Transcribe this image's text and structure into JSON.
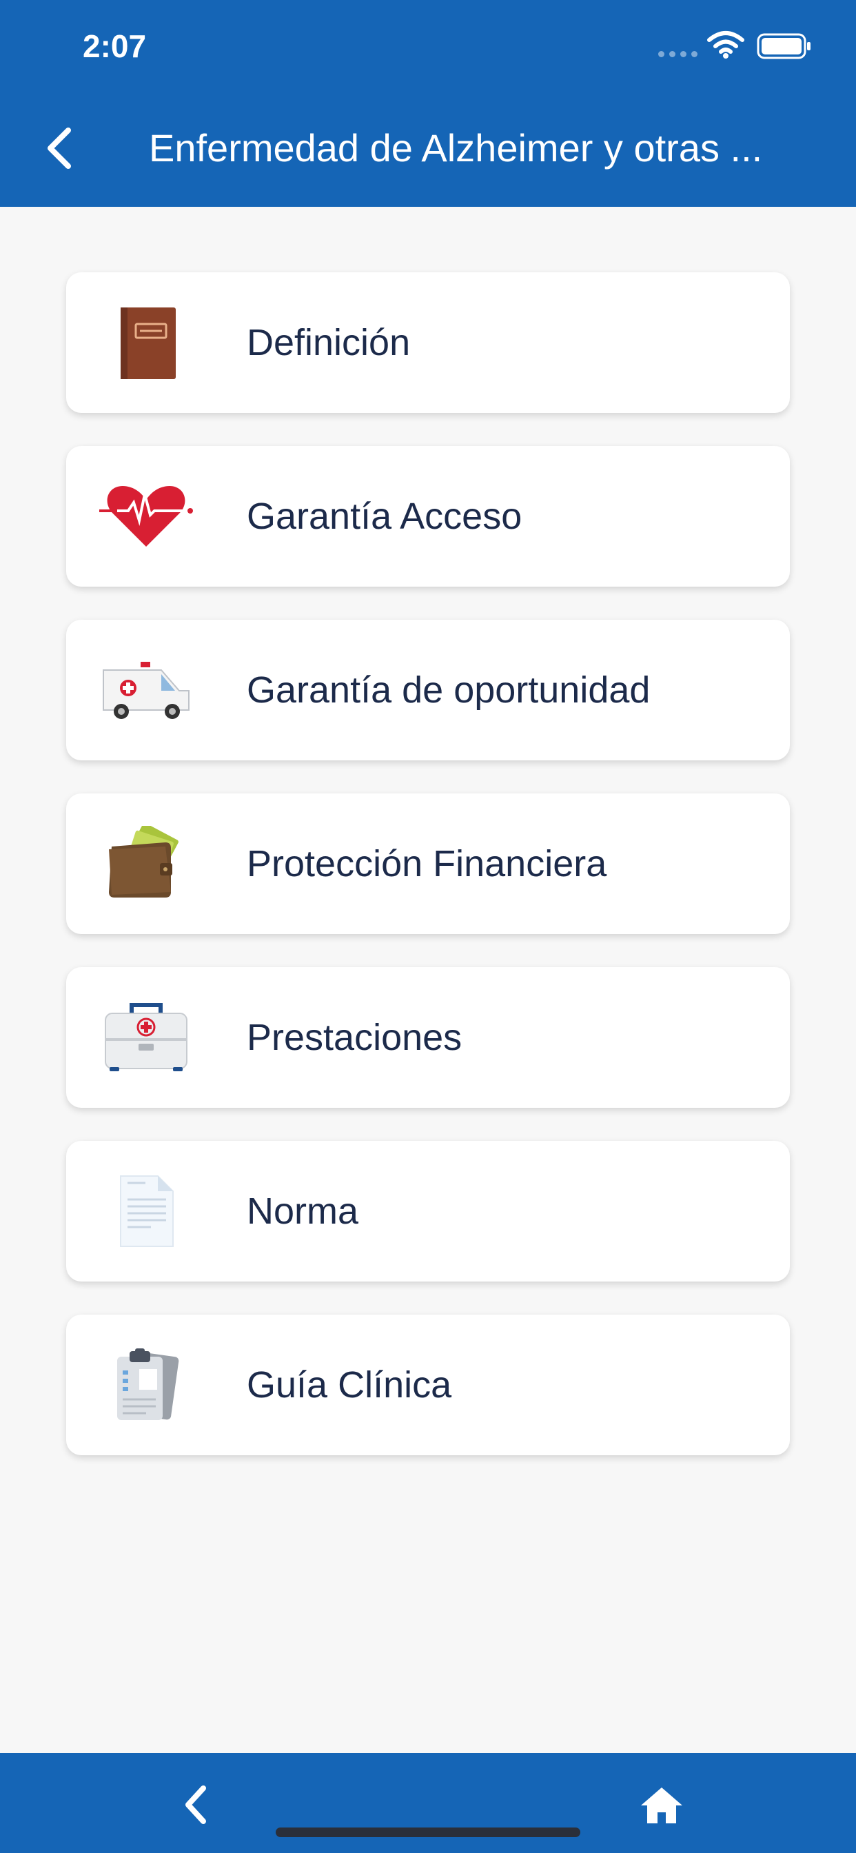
{
  "status_bar": {
    "time": "2:07"
  },
  "header": {
    "title": "Enfermedad de Alzheimer y otras ..."
  },
  "menu": {
    "items": [
      {
        "label": "Definición",
        "icon": "book-icon"
      },
      {
        "label": "Garantía Acceso",
        "icon": "heart-pulse-icon"
      },
      {
        "label": "Garantía de oportunidad",
        "icon": "ambulance-icon"
      },
      {
        "label": "Protección Financiera",
        "icon": "wallet-icon"
      },
      {
        "label": "Prestaciones",
        "icon": "first-aid-kit-icon"
      },
      {
        "label": "Norma",
        "icon": "document-icon"
      },
      {
        "label": "Guía Clínica",
        "icon": "clipboard-icon"
      }
    ]
  },
  "colors": {
    "brand": "#1565b6",
    "background": "#f7f7f7",
    "text": "#1c2a4a"
  }
}
